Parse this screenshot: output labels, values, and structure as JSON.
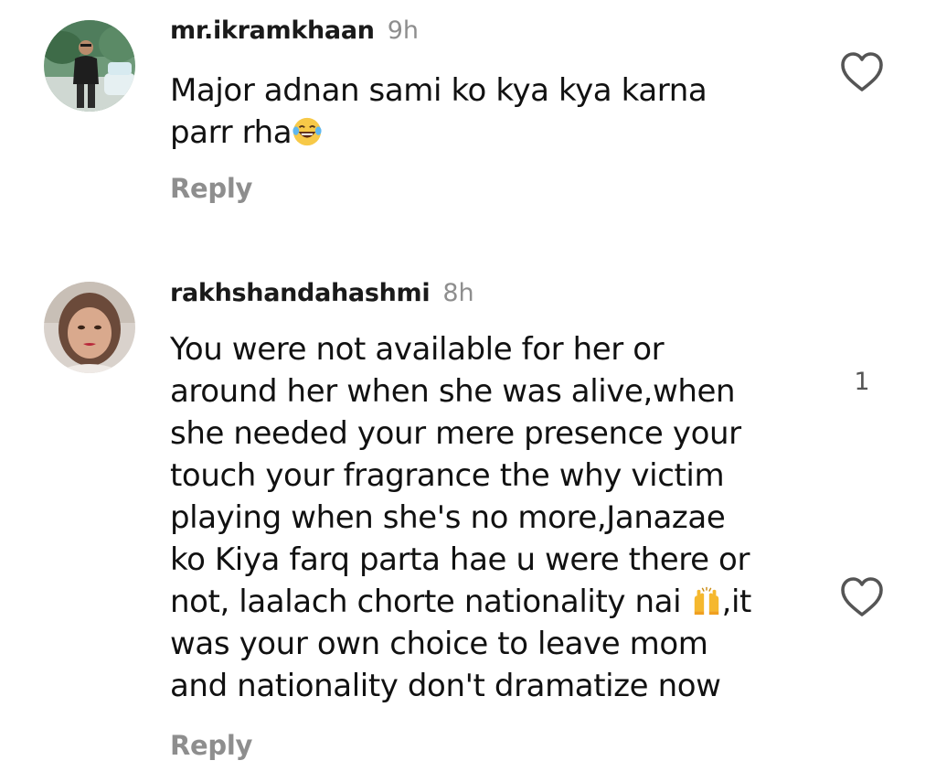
{
  "comments": [
    {
      "username": "mr.ikramkhaan",
      "time": "9h",
      "text_lines": [
        "Major adnan sami ko kya kya karna",
        "parr rha"
      ],
      "trailing_emoji": "laughing-tears-emoji",
      "reply_label": "Reply",
      "like_icon": "heart-outline-icon",
      "avatar": "user-avatar-photo"
    },
    {
      "username": "rakhshandahashmi",
      "time": "8h",
      "text_lines": [
        "You were not available for her or",
        "around her when she was alive,when",
        "she needed your mere presence your",
        "touch your fragrance the why victim",
        "playing when she's no more,Janazae",
        "ko Kiya farq parta hae u were there or",
        "not, laalach chorte nationality nai",
        ",it",
        "was your own choice to leave mom",
        "and nationality don't dramatize now"
      ],
      "inline_emoji": "raising-hands-emoji",
      "reply_label": "Reply",
      "like_icon": "heart-outline-icon",
      "like_count": "1",
      "avatar": "user-avatar-photo"
    }
  ],
  "colors": {
    "primary_text": "#111111",
    "secondary_text": "#8e8e8e",
    "background": "#ffffff"
  }
}
